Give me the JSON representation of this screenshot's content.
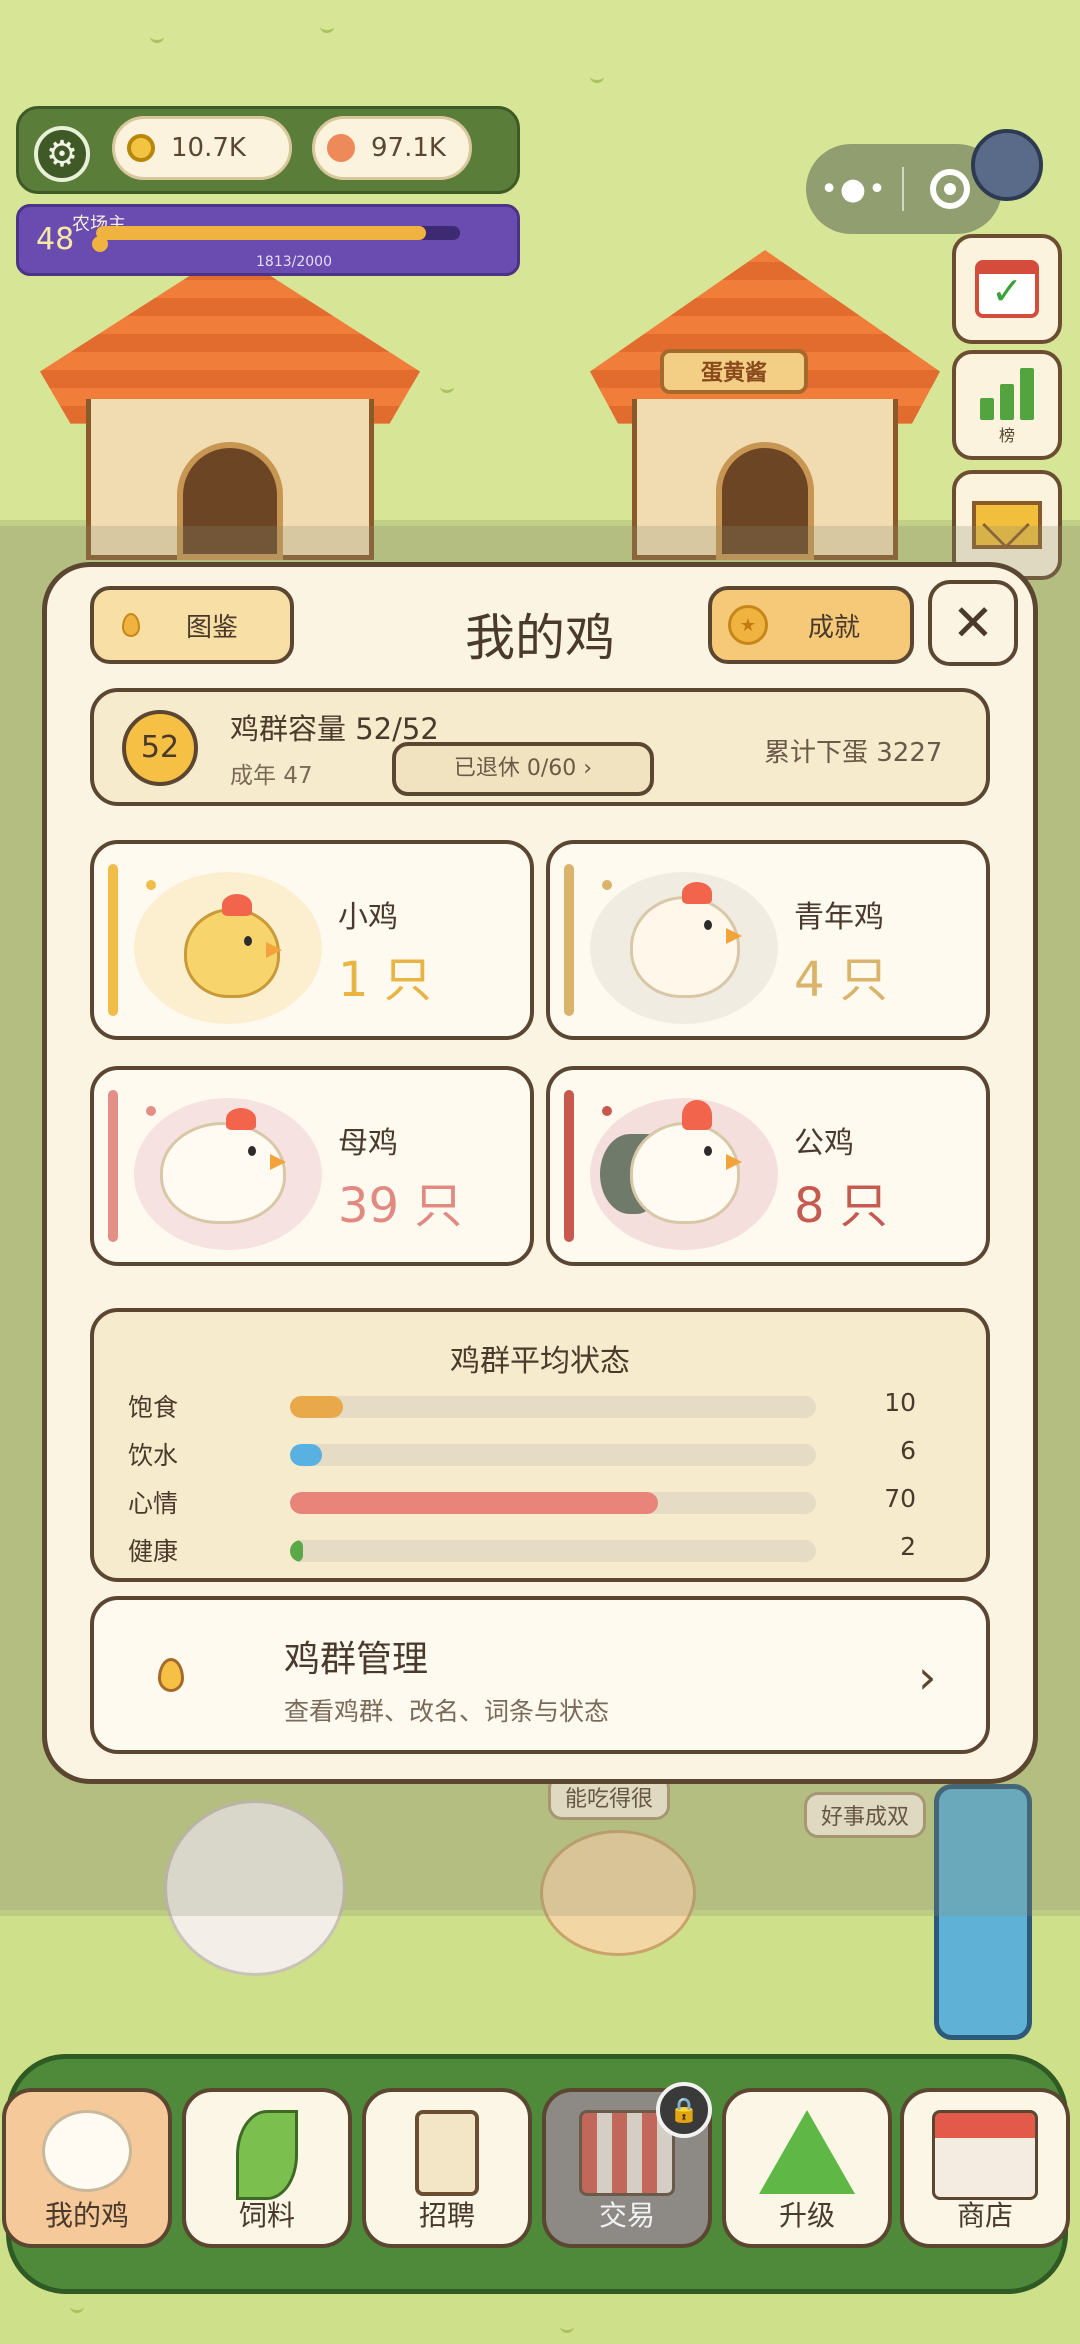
{
  "hud": {
    "coins": "10.7K",
    "gems": "97.1K",
    "level": "48",
    "level_title": "农场主",
    "xp_text": "1813/2000",
    "xp_progress": 0.9065
  },
  "side_buttons": {
    "ranking_label": "榜"
  },
  "scene": {
    "house_sign": "蛋黄酱",
    "bubble_1": "能吃得很",
    "bubble_2": "好事成双"
  },
  "dialog": {
    "title": "我的鸡",
    "left_button": "图鉴",
    "right_button": "成就",
    "capacity": {
      "badge": "52",
      "title": "鸡群容量 52/52",
      "adult": "成年 47",
      "retired": "已退休 0/60 ›",
      "total_eggs": "累计下蛋 3227"
    },
    "categories": [
      {
        "name": "小鸡",
        "count": "1 只",
        "color": "#f0be48"
      },
      {
        "name": "青年鸡",
        "count": "4 只",
        "color": "#d9b46a"
      },
      {
        "name": "母鸡",
        "count": "39 只",
        "color": "#e38e86"
      },
      {
        "name": "公鸡",
        "count": "8 只",
        "color": "#c8574e"
      }
    ],
    "stats": {
      "title": "鸡群平均状态",
      "rows": [
        {
          "label": "饱食",
          "value": "10",
          "progress": 0.1,
          "color": "#e9a84a"
        },
        {
          "label": "饮水",
          "value": "6",
          "progress": 0.06,
          "color": "#58b1e0"
        },
        {
          "label": "心情",
          "value": "70",
          "progress": 0.7,
          "color": "#e8847a"
        },
        {
          "label": "健康",
          "value": "2",
          "progress": 0.02,
          "color": "#5aa847"
        }
      ]
    },
    "management": {
      "title": "鸡群管理",
      "subtitle": "查看鸡群、改名、词条与状态",
      "arrow": "›"
    }
  },
  "nav": {
    "items": [
      {
        "label": "我的鸡",
        "active": true
      },
      {
        "label": "饲料"
      },
      {
        "label": "招聘"
      },
      {
        "label": "交易",
        "locked": true
      },
      {
        "label": "升级"
      },
      {
        "label": "商店"
      }
    ]
  }
}
